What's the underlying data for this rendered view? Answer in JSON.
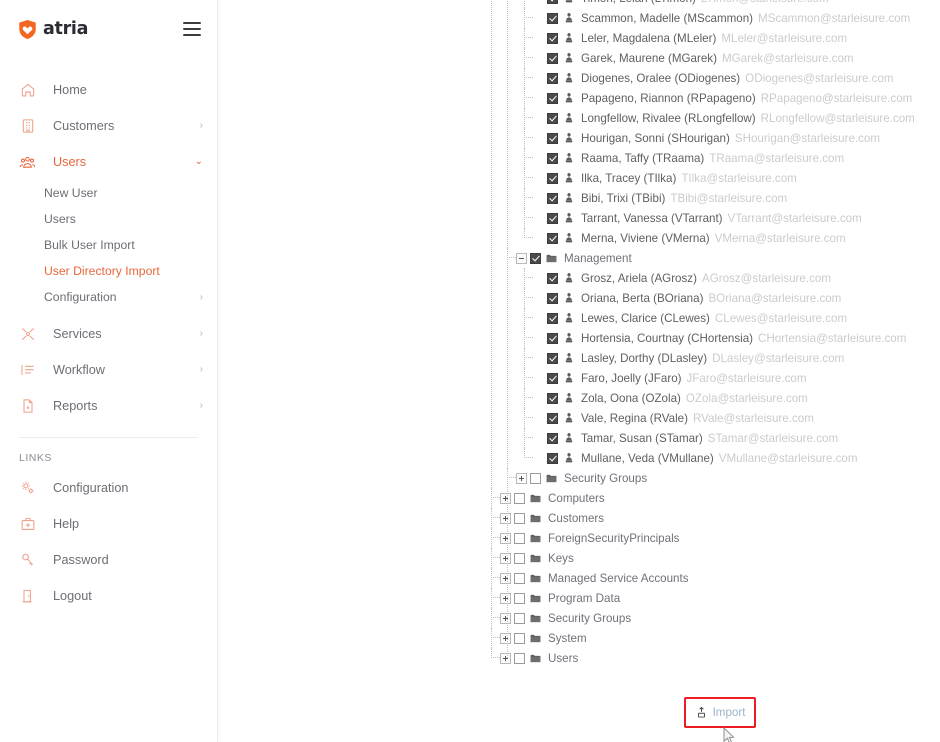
{
  "brand": {
    "name": "atria",
    "logo_icon": "shield-heart-logo",
    "menu_toggle_icon": "hamburger-icon",
    "accent_color": "#e8663b",
    "icon_color": "#eda28c"
  },
  "sidebar": {
    "items": [
      {
        "label": "Home",
        "icon": "home-icon",
        "caret": "",
        "active": false
      },
      {
        "label": "Customers",
        "icon": "building-icon",
        "caret": "›",
        "active": false
      },
      {
        "label": "Users",
        "icon": "users-group-icon",
        "caret": "⌄",
        "active": true
      }
    ],
    "users_subitems": [
      {
        "label": "New User",
        "active": false,
        "caret": ""
      },
      {
        "label": "Users",
        "active": false,
        "caret": ""
      },
      {
        "label": "Bulk User Import",
        "active": false,
        "caret": ""
      },
      {
        "label": "User Directory Import",
        "active": true,
        "caret": ""
      },
      {
        "label": "Configuration",
        "active": false,
        "caret": "›"
      }
    ],
    "items_after": [
      {
        "label": "Services",
        "icon": "tools-icon",
        "caret": "›",
        "active": false
      },
      {
        "label": "Workflow",
        "icon": "list-icon",
        "caret": "›",
        "active": false
      },
      {
        "label": "Reports",
        "icon": "report-document-icon",
        "caret": "›",
        "active": false
      }
    ],
    "links_section_title": "LINKS",
    "links": [
      {
        "label": "Configuration",
        "icon": "gears-icon"
      },
      {
        "label": "Help",
        "icon": "first-aid-kit-icon"
      },
      {
        "label": "Password",
        "icon": "key-icon"
      },
      {
        "label": "Logout",
        "icon": "logout-door-icon"
      }
    ]
  },
  "tree": {
    "checkbox_checked_color": "#4a4a4a",
    "email_color": "#cbcbcb",
    "name_color": "#5f5f63",
    "rows": [
      {
        "depth": 2,
        "type": "user",
        "checked": true,
        "name": "Timon, Lelah (LTimon)",
        "email": "LTimon@starleisure.com",
        "toggle": "none",
        "clipped": true
      },
      {
        "depth": 2,
        "type": "user",
        "checked": true,
        "name": "Scammon, Madelle (MScammon)",
        "email": "MScammon@starleisure.com",
        "toggle": "none"
      },
      {
        "depth": 2,
        "type": "user",
        "checked": true,
        "name": "Leler, Magdalena (MLeler)",
        "email": "MLeler@starleisure.com",
        "toggle": "none"
      },
      {
        "depth": 2,
        "type": "user",
        "checked": true,
        "name": "Garek, Maurene (MGarek)",
        "email": "MGarek@starleisure.com",
        "toggle": "none"
      },
      {
        "depth": 2,
        "type": "user",
        "checked": true,
        "name": "Diogenes, Oralee (ODiogenes)",
        "email": "ODiogenes@starleisure.com",
        "toggle": "none"
      },
      {
        "depth": 2,
        "type": "user",
        "checked": true,
        "name": "Papageno, Riannon (RPapageno)",
        "email": "RPapageno@starleisure.com",
        "toggle": "none"
      },
      {
        "depth": 2,
        "type": "user",
        "checked": true,
        "name": "Longfellow, Rivalee (RLongfellow)",
        "email": "RLongfellow@starleisure.com",
        "toggle": "none"
      },
      {
        "depth": 2,
        "type": "user",
        "checked": true,
        "name": "Hourigan, Sonni (SHourigan)",
        "email": "SHourigan@starleisure.com",
        "toggle": "none"
      },
      {
        "depth": 2,
        "type": "user",
        "checked": true,
        "name": "Raama, Taffy (TRaama)",
        "email": "TRaama@starleisure.com",
        "toggle": "none"
      },
      {
        "depth": 2,
        "type": "user",
        "checked": true,
        "name": "Ilka, Tracey (TIlka)",
        "email": "TIlka@starleisure.com",
        "toggle": "none"
      },
      {
        "depth": 2,
        "type": "user",
        "checked": true,
        "name": "Bibi, Trixi (TBibi)",
        "email": "TBibi@starleisure.com",
        "toggle": "none"
      },
      {
        "depth": 2,
        "type": "user",
        "checked": true,
        "name": "Tarrant, Vanessa (VTarrant)",
        "email": "VTarrant@starleisure.com",
        "toggle": "none"
      },
      {
        "depth": 2,
        "type": "user",
        "checked": true,
        "name": "Merna, Viviene (VMerna)",
        "email": "VMerna@starleisure.com",
        "toggle": "none",
        "last": true
      },
      {
        "depth": 1,
        "type": "folder",
        "checked": true,
        "name": "Management",
        "email": "",
        "toggle": "minus"
      },
      {
        "depth": 2,
        "type": "user",
        "checked": true,
        "name": "Grosz, Ariela (AGrosz)",
        "email": "AGrosz@starleisure.com",
        "toggle": "none"
      },
      {
        "depth": 2,
        "type": "user",
        "checked": true,
        "name": "Oriana, Berta (BOriana)",
        "email": "BOriana@starleisure.com",
        "toggle": "none"
      },
      {
        "depth": 2,
        "type": "user",
        "checked": true,
        "name": "Lewes, Clarice (CLewes)",
        "email": "CLewes@starleisure.com",
        "toggle": "none"
      },
      {
        "depth": 2,
        "type": "user",
        "checked": true,
        "name": "Hortensia, Courtnay (CHortensia)",
        "email": "CHortensia@starleisure.com",
        "toggle": "none"
      },
      {
        "depth": 2,
        "type": "user",
        "checked": true,
        "name": "Lasley, Dorthy (DLasley)",
        "email": "DLasley@starleisure.com",
        "toggle": "none"
      },
      {
        "depth": 2,
        "type": "user",
        "checked": true,
        "name": "Faro, Joelly (JFaro)",
        "email": "JFaro@starleisure.com",
        "toggle": "none"
      },
      {
        "depth": 2,
        "type": "user",
        "checked": true,
        "name": "Zola, Oona (OZola)",
        "email": "OZola@starleisure.com",
        "toggle": "none"
      },
      {
        "depth": 2,
        "type": "user",
        "checked": true,
        "name": "Vale, Regina (RVale)",
        "email": "RVale@starleisure.com",
        "toggle": "none"
      },
      {
        "depth": 2,
        "type": "user",
        "checked": true,
        "name": "Tamar, Susan (STamar)",
        "email": "STamar@starleisure.com",
        "toggle": "none"
      },
      {
        "depth": 2,
        "type": "user",
        "checked": true,
        "name": "Mullane, Veda (VMullane)",
        "email": "VMullane@starleisure.com",
        "toggle": "none",
        "last": true
      },
      {
        "depth": 1,
        "type": "folder",
        "checked": false,
        "name": "Security Groups",
        "email": "",
        "toggle": "plus",
        "last": true
      },
      {
        "depth": 0,
        "type": "folder",
        "checked": false,
        "name": "Computers",
        "email": "",
        "toggle": "plus"
      },
      {
        "depth": 0,
        "type": "folder",
        "checked": false,
        "name": "Customers",
        "email": "",
        "toggle": "plus"
      },
      {
        "depth": 0,
        "type": "folder",
        "checked": false,
        "name": "ForeignSecurityPrincipals",
        "email": "",
        "toggle": "plus"
      },
      {
        "depth": 0,
        "type": "folder",
        "checked": false,
        "name": "Keys",
        "email": "",
        "toggle": "plus"
      },
      {
        "depth": 0,
        "type": "folder",
        "checked": false,
        "name": "Managed Service Accounts",
        "email": "",
        "toggle": "plus"
      },
      {
        "depth": 0,
        "type": "folder",
        "checked": false,
        "name": "Program Data",
        "email": "",
        "toggle": "plus"
      },
      {
        "depth": 0,
        "type": "folder",
        "checked": false,
        "name": "Security Groups",
        "email": "",
        "toggle": "plus"
      },
      {
        "depth": 0,
        "type": "folder",
        "checked": false,
        "name": "System",
        "email": "",
        "toggle": "plus"
      },
      {
        "depth": 0,
        "type": "folder",
        "checked": false,
        "name": "Users",
        "email": "",
        "toggle": "plus",
        "last": true
      }
    ]
  },
  "import": {
    "label": "Import",
    "icon": "import-upload-icon",
    "highlight_color": "#ee1b24"
  }
}
